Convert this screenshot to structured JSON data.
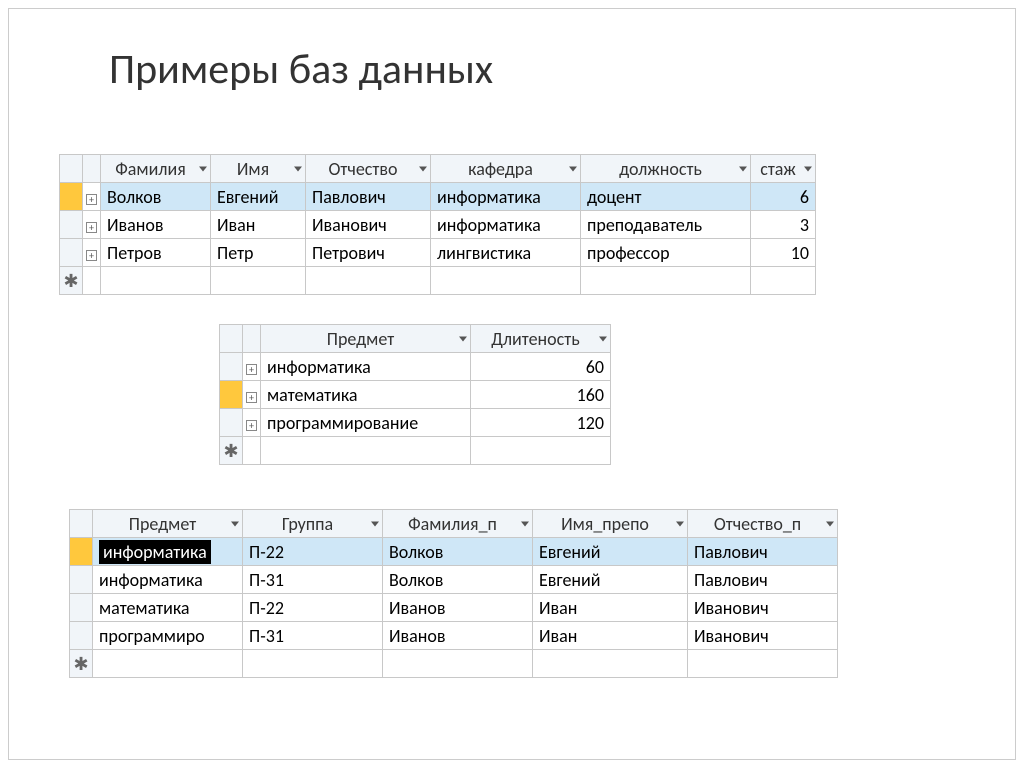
{
  "title": "Примеры баз данных",
  "table1": {
    "headers": [
      "Фамилия",
      "Имя",
      "Отчество",
      "кафедра",
      "должность",
      "стаж"
    ],
    "rows": [
      {
        "lastname": "Волков",
        "name": "Евгений",
        "patronymic": "Павлович",
        "dept": "информатика",
        "position": "доцент",
        "years": "6"
      },
      {
        "lastname": "Иванов",
        "name": "Иван",
        "patronymic": "Иванович",
        "dept": "информатика",
        "position": "преподаватель",
        "years": "3"
      },
      {
        "lastname": "Петров",
        "name": "Петр",
        "patronymic": "Петрович",
        "dept": "лингвистика",
        "position": "профессор",
        "years": "10"
      }
    ]
  },
  "table2": {
    "headers": [
      "Предмет",
      "Длитеность"
    ],
    "rows": [
      {
        "subject": "информатика",
        "duration": "60"
      },
      {
        "subject": "математика",
        "duration": "160"
      },
      {
        "subject": "программирование",
        "duration": "120"
      }
    ]
  },
  "table3": {
    "headers": [
      "Предмет",
      "Группа",
      "Фамилия_п",
      "Имя_препо",
      "Отчество_п"
    ],
    "rows": [
      {
        "subject": "информатика",
        "group": "П-22",
        "lastname": "Волков",
        "name": "Евгений",
        "patronymic": "Павлович"
      },
      {
        "subject": "информатика",
        "group": "П-31",
        "lastname": "Волков",
        "name": "Евгений",
        "patronymic": "Павлович"
      },
      {
        "subject": "математика",
        "group": "П-22",
        "lastname": "Иванов",
        "name": "Иван",
        "patronymic": "Иванович"
      },
      {
        "subject": "программиро",
        "group": "П-31",
        "lastname": "Иванов",
        "name": "Иван",
        "patronymic": "Иванович"
      }
    ]
  }
}
